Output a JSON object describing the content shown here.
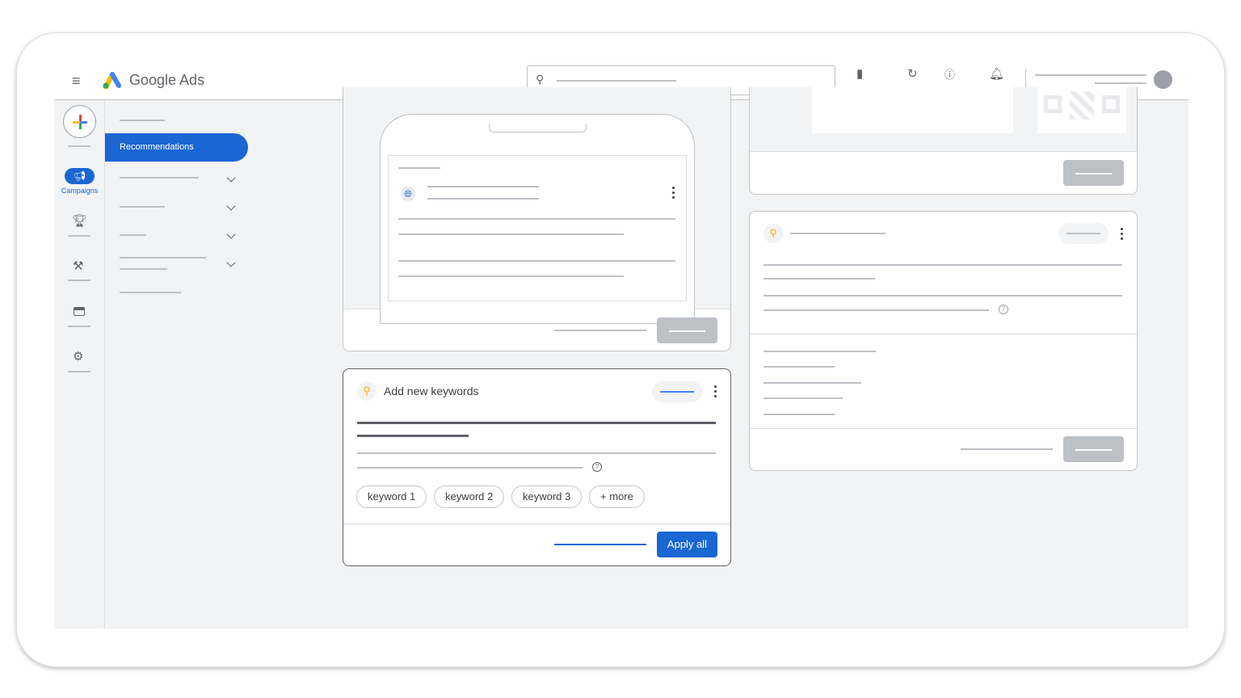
{
  "app": {
    "name": "Google Ads"
  },
  "nav": {
    "create_icon": "plus-icon",
    "campaigns_label": "Campaigns",
    "active_item": "Recommendations"
  },
  "header": {
    "icons": [
      "menu-icon",
      "search-icon",
      "reports-icon",
      "refresh-icon",
      "help-icon",
      "bell-icon",
      "avatar"
    ]
  },
  "keyword_card": {
    "title": "Add new keywords",
    "chips": [
      "keyword 1",
      "keyword 2",
      "keyword 3",
      "+ more"
    ],
    "apply_label": "Apply all"
  },
  "colors": {
    "primary": "#1a66d2",
    "background": "#f1f3f4",
    "placeholder": "#bdc1c6"
  }
}
